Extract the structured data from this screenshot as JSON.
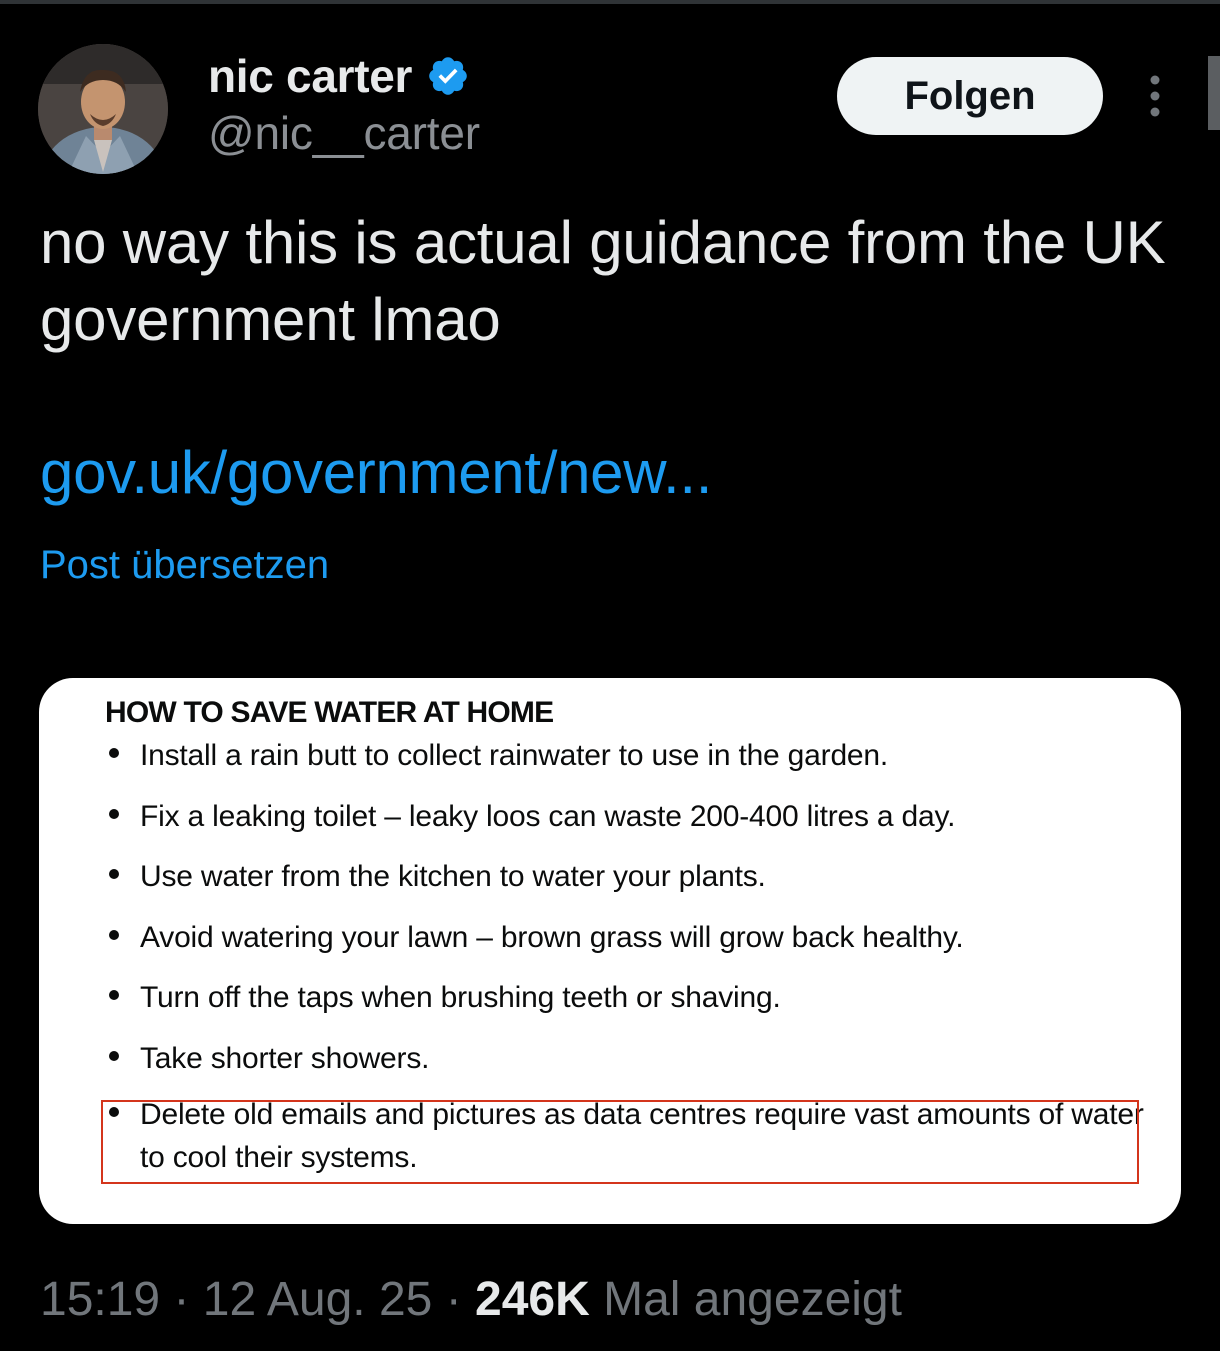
{
  "author": {
    "display_name": "nic carter",
    "handle": "@nic__carter",
    "verified": true
  },
  "follow_button": {
    "label": "Folgen"
  },
  "tweet": {
    "text": "no way this is actual guidance from the UK government lmao",
    "link": "gov.uk/government/new...",
    "translate_label": "Post übersetzen"
  },
  "image": {
    "heading": "HOW TO SAVE WATER AT HOME",
    "items": [
      "Install a rain butt to collect rainwater to use in the garden.",
      "Fix a leaking toilet – leaky loos can waste 200-400 litres a day.",
      "Use water from the kitchen to water your plants.",
      "Avoid watering your lawn – brown grass will grow back healthy.",
      "Turn off the taps when brushing teeth or shaving.",
      "Take shorter showers.",
      "Delete old emails and pictures as data centres require vast amounts of water to cool their systems."
    ],
    "highlight_color": "#d4351c"
  },
  "meta": {
    "time": "15:19",
    "separator": "·",
    "date": "12 Aug. 25",
    "views_count": "246K",
    "views_label": "Mal angezeigt"
  },
  "colors": {
    "background": "#000000",
    "text_primary": "#e7e9ea",
    "text_secondary": "#71767b",
    "link": "#1d9bf0",
    "verified": "#1d9bf0"
  },
  "icons": {
    "verified": "verified-badge-icon",
    "more": "more-vertical-icon"
  }
}
